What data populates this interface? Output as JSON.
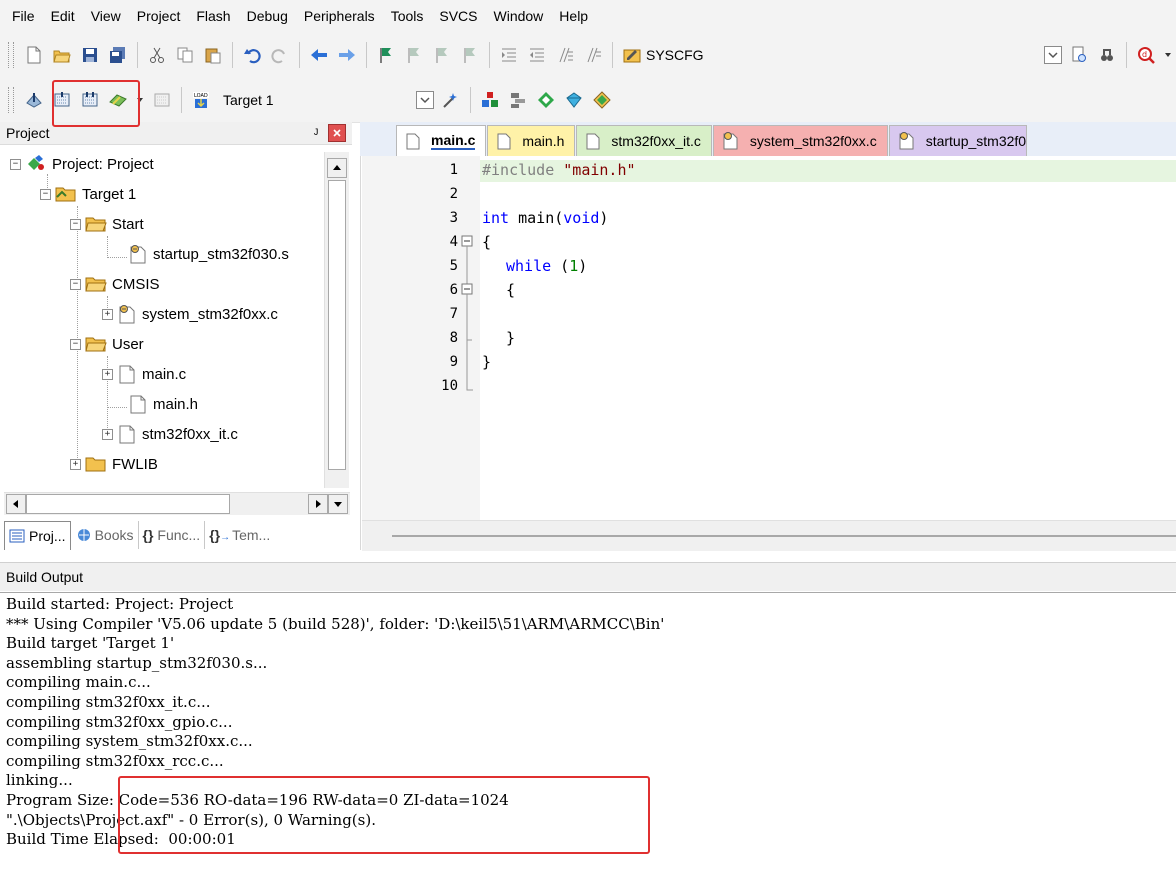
{
  "menu": [
    "File",
    "Edit",
    "View",
    "Project",
    "Flash",
    "Debug",
    "Peripherals",
    "Tools",
    "SVCS",
    "Window",
    "Help"
  ],
  "toolbar1": {
    "config_label": "SYSCFG"
  },
  "toolbar2": {
    "target_label": "Target 1",
    "load_label": "LOAD"
  },
  "project_panel": {
    "title": "Project",
    "tree": [
      {
        "label": "Project: Project",
        "level": 0
      },
      {
        "label": "Target 1",
        "level": 1
      },
      {
        "label": "Start",
        "level": 2
      },
      {
        "label": "startup_stm32f030.s",
        "level": 3
      },
      {
        "label": "CMSIS",
        "level": 2
      },
      {
        "label": "system_stm32f0xx.c",
        "level": 3
      },
      {
        "label": "User",
        "level": 2
      },
      {
        "label": "main.c",
        "level": 3
      },
      {
        "label": "main.h",
        "level": 3
      },
      {
        "label": "stm32f0xx_it.c",
        "level": 3
      },
      {
        "label": "FWLIB",
        "level": 2
      }
    ],
    "tabs": [
      "Proj...",
      "Books",
      "Func...",
      "Tem..."
    ]
  },
  "editor": {
    "tabs": [
      {
        "label": "main.c",
        "color": "#ffffff"
      },
      {
        "label": "main.h",
        "color": "#fff2a8"
      },
      {
        "label": "stm32f0xx_it.c",
        "color": "#d8efc8"
      },
      {
        "label": "system_stm32f0xx.c",
        "color": "#f5b0b0"
      },
      {
        "label": "startup_stm32f0",
        "color": "#d8c8ef"
      }
    ],
    "line_numbers": [
      "1",
      "2",
      "3",
      "4",
      "5",
      "6",
      "7",
      "8",
      "9",
      "10"
    ],
    "code": {
      "l1_directive": "#include",
      "l1_string": " \"main.h\"",
      "l3_keyword": "int",
      "l3_name": " main(",
      "l3_param": "void",
      "l3_close": ")",
      "l4": "{",
      "l5_keyword": "while",
      "l5_open": " (",
      "l5_num": "1",
      "l5_close": ")",
      "l6": "{",
      "l8": "}",
      "l9": "}"
    }
  },
  "build_output": {
    "title": "Build Output",
    "lines": [
      "Build started: Project: Project",
      "*** Using Compiler 'V5.06 update 5 (build 528)', folder: 'D:\\keil5\\51\\ARM\\ARMCC\\Bin'",
      "Build target 'Target 1'",
      "assembling startup_stm32f030.s...",
      "compiling main.c...",
      "compiling stm32f0xx_it.c...",
      "compiling stm32f0xx_gpio.c...",
      "compiling system_stm32f0xx.c...",
      "compiling stm32f0xx_rcc.c...",
      "linking...",
      "Program Size: Code=536 RO-data=196 RW-data=0 ZI-data=1024",
      "\".\\Objects\\Project.axf\" - 0 Error(s), 0 Warning(s).",
      "Build Time Elapsed:  00:00:01"
    ]
  },
  "colors": {
    "highlight_box": "#e03030",
    "current_line": "#e6f5e0",
    "keyword": "#0000ff",
    "string": "#800000",
    "number": "#008000"
  }
}
